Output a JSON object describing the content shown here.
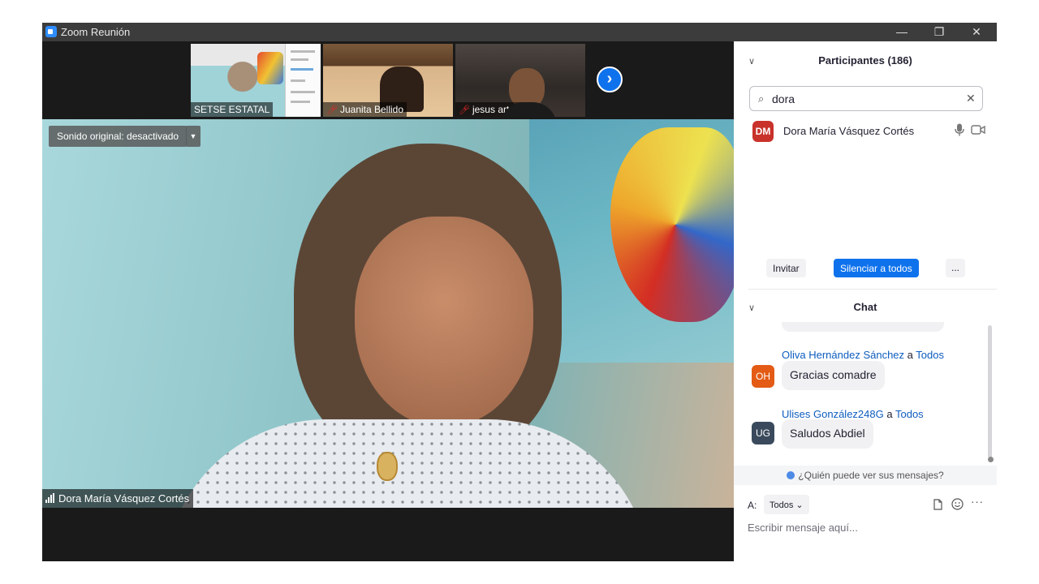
{
  "window": {
    "title": "Zoom Reunión"
  },
  "thumbnails": [
    {
      "name": "SETSE ESTATAL",
      "muted": false
    },
    {
      "name": "Juanita Bellido",
      "muted": true
    },
    {
      "name": "jesus arturo",
      "muted": true
    }
  ],
  "main_video": {
    "original_sound": "Sonido original: desactivado",
    "speaker": "Dora María Vásquez Cortés"
  },
  "participants": {
    "title": "Participantes (186)",
    "search_value": "dora",
    "list": [
      {
        "initials": "DM",
        "name": "Dora María Vásquez Cortés",
        "avatar_color": "#c8322b"
      }
    ],
    "invite_label": "Invitar",
    "mute_all_label": "Silenciar a todos",
    "more_label": "..."
  },
  "chat": {
    "title": "Chat",
    "messages": [
      {
        "initials": "OH",
        "sender": "Oliva Hernández Sánchez",
        "to_word": "a",
        "target": "Todos",
        "text": "Gracias comadre",
        "avatar_color": "#e35b15"
      },
      {
        "initials": "UG",
        "sender": "Ulises González248G",
        "to_word": "a",
        "target": "Todos",
        "text": "Saludos Abdiel",
        "avatar_color": "#3a4a5c"
      }
    ],
    "who_can_see": "¿Quién puede ver sus mensajes?",
    "to_label": "A:",
    "to_value": "Todos",
    "input_placeholder": "Escribir mensaje aquí...",
    "more_label": "···"
  },
  "colors": {
    "accent": "#0e72ed",
    "titlebar": "#3c3c3c",
    "link": "#0e5dbf"
  }
}
